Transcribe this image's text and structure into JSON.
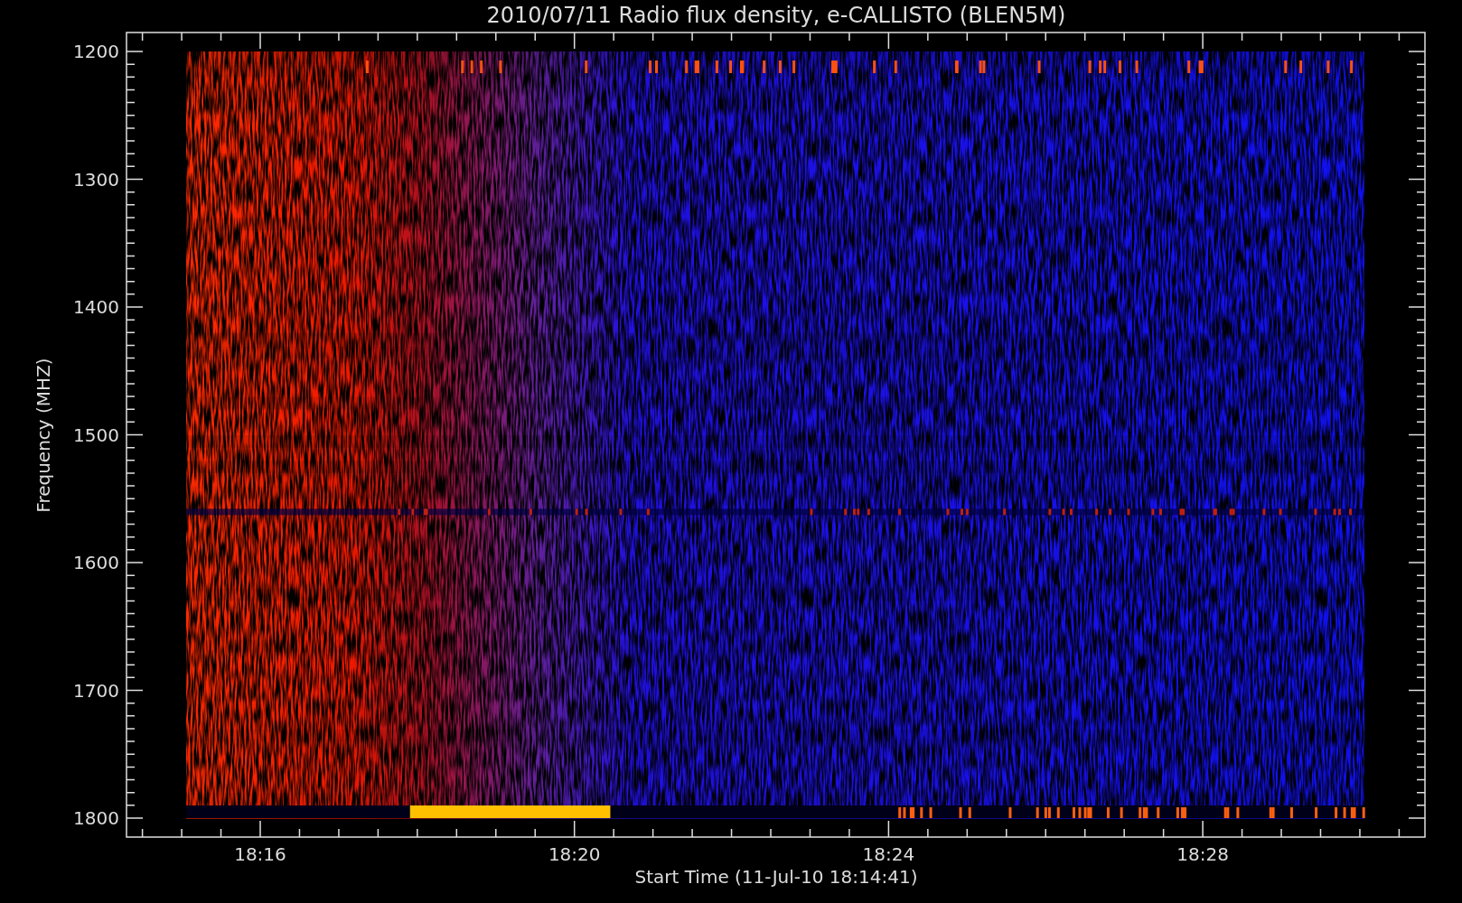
{
  "title": "2010/07/11  Radio flux density, e-CALLISTO (BLEN5M)",
  "y_axis": {
    "label": "Frequency (MHZ)",
    "ticks": [
      "1200",
      "1300",
      "1400",
      "1500",
      "1600",
      "1700",
      "1800"
    ]
  },
  "x_axis": {
    "label": "Start Time (11-Jul-10 18:14:41)",
    "ticks": [
      "18:16",
      "18:20",
      "18:24",
      "18:28"
    ]
  }
}
